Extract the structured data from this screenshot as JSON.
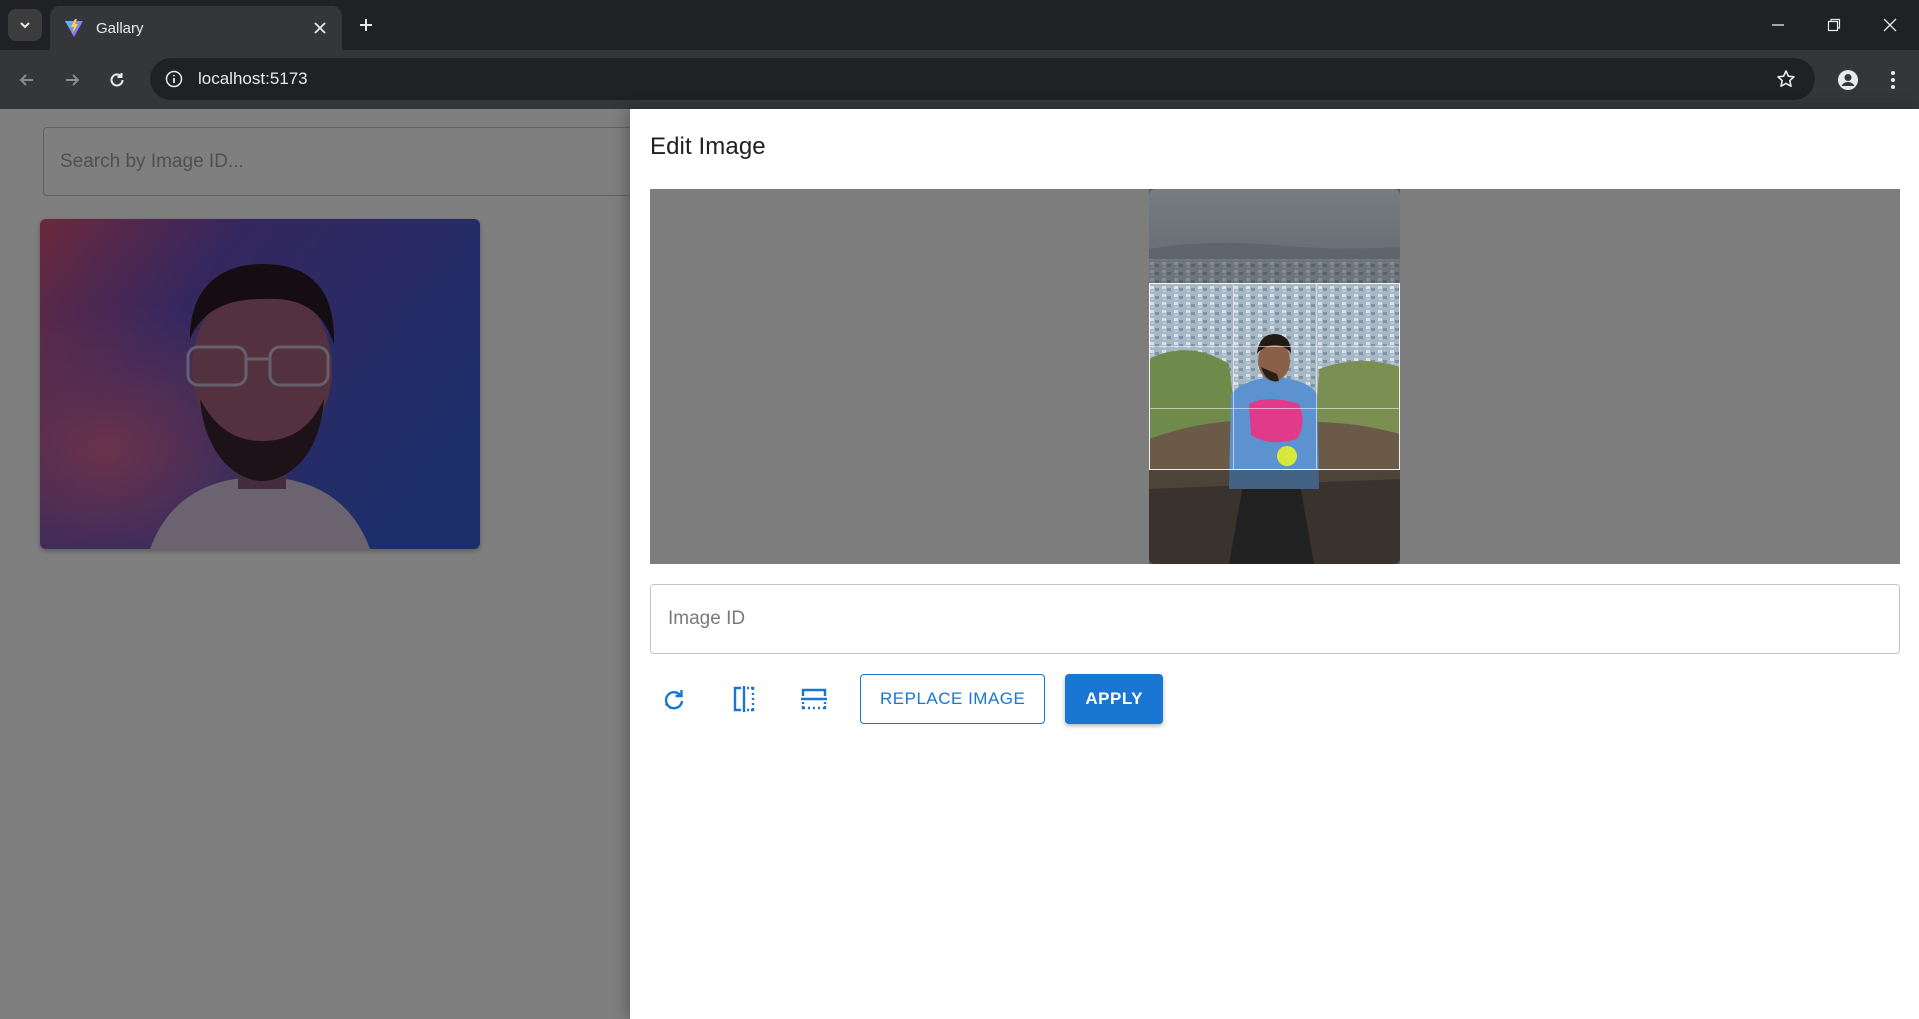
{
  "browser": {
    "tab_title": "Gallary",
    "url": "localhost:5173"
  },
  "page": {
    "search_placeholder": "Search by Image ID..."
  },
  "drawer": {
    "title": "Edit Image",
    "image_id_placeholder": "Image ID",
    "replace_label": "REPLACE IMAGE",
    "apply_label": "APPLY"
  },
  "colors": {
    "accent": "#1976d2",
    "chrome_dark": "#202124",
    "chrome_toolbar": "#35363a",
    "cropper_bg": "#7d7d7d"
  },
  "icons": {
    "tab_search": "chevron-down-icon",
    "favicon": "vite-logo-icon",
    "tab_close": "close-icon",
    "new_tab": "plus-icon",
    "back": "arrow-left-icon",
    "forward": "arrow-right-icon",
    "reload": "reload-icon",
    "site_info": "info-icon",
    "bookmark": "star-icon",
    "profile": "person-icon",
    "menu": "more-vert-icon",
    "rotate": "rotate-right-icon",
    "flip_horizontal": "flip-horizontal-icon",
    "flip_vertical": "flip-vertical-icon"
  }
}
